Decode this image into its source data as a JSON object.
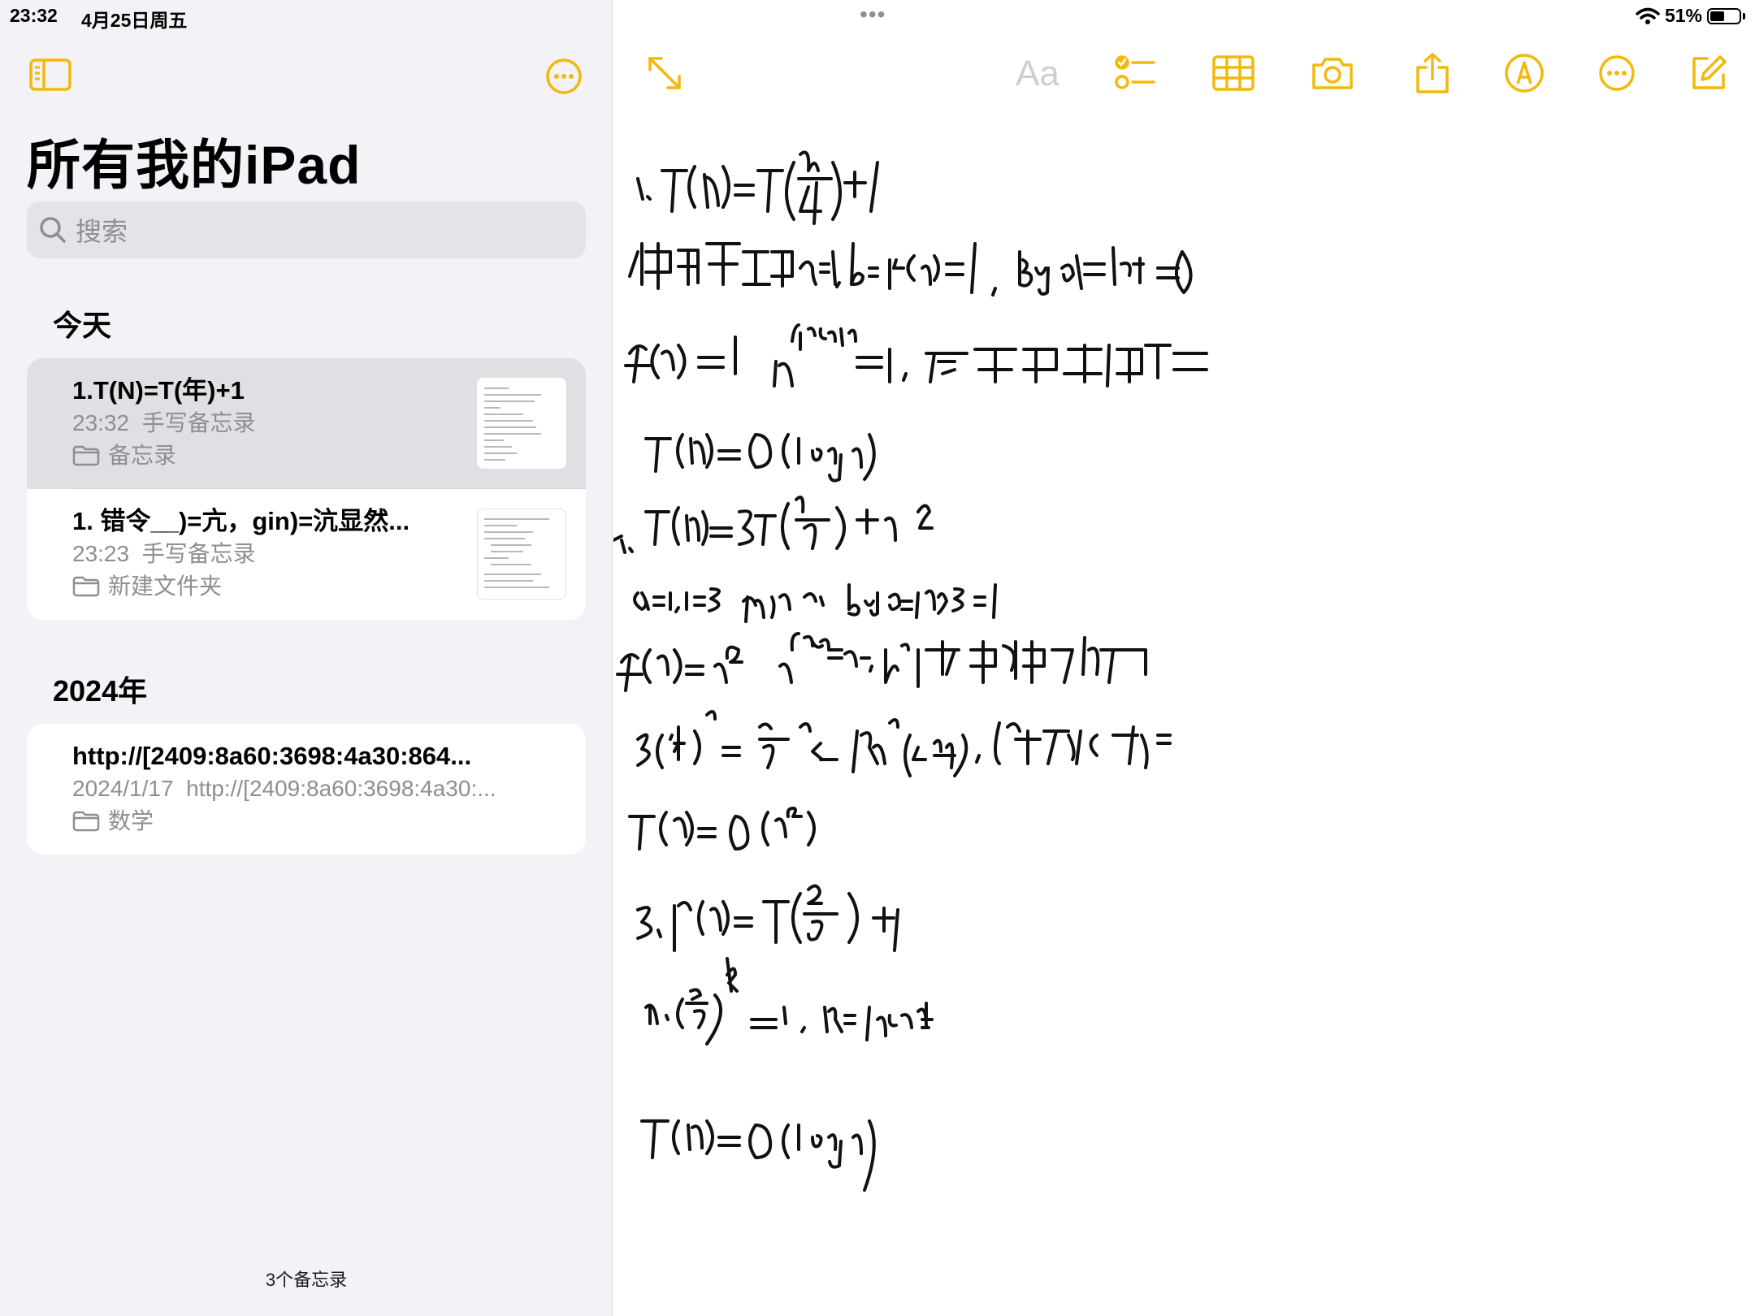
{
  "status_bar": {
    "time": "23:32",
    "date": "4月25日周五",
    "battery": "51%",
    "battery_level": 0.51
  },
  "colors": {
    "accent": "#f2b90c",
    "sidebar_bg": "#f2f2f7",
    "selected_row": "#dfdfe4",
    "secondary_text": "#8e8e93"
  },
  "sidebar": {
    "title": "所有我的iPad",
    "search_placeholder": "搜索",
    "sections": [
      {
        "header": "今天",
        "notes": [
          {
            "title": "1.T(N)=T(年)+1",
            "time": "23:32",
            "preview": "手写备忘录",
            "folder": "备忘录",
            "selected": true
          },
          {
            "title": "1. 错令__)=亢，gin)=沆显然...",
            "time": "23:23",
            "preview": "手写备忘录",
            "folder": "新建文件夹",
            "selected": false
          }
        ]
      },
      {
        "header": "2024年",
        "notes": [
          {
            "title": "http://[2409:8a60:3698:4a30:864...",
            "time": "2024/1/17",
            "preview": "http://[2409:8a60:3698:4a30:...",
            "folder": "数学",
            "selected": false
          }
        ]
      }
    ],
    "note_count": "3个备忘录"
  },
  "toolbar": {
    "format_label": "Aa",
    "icons": [
      "expand-icon",
      "checklist-icon",
      "table-icon",
      "camera-icon",
      "share-icon",
      "markup-pen-icon",
      "more-icon",
      "compose-icon"
    ]
  }
}
